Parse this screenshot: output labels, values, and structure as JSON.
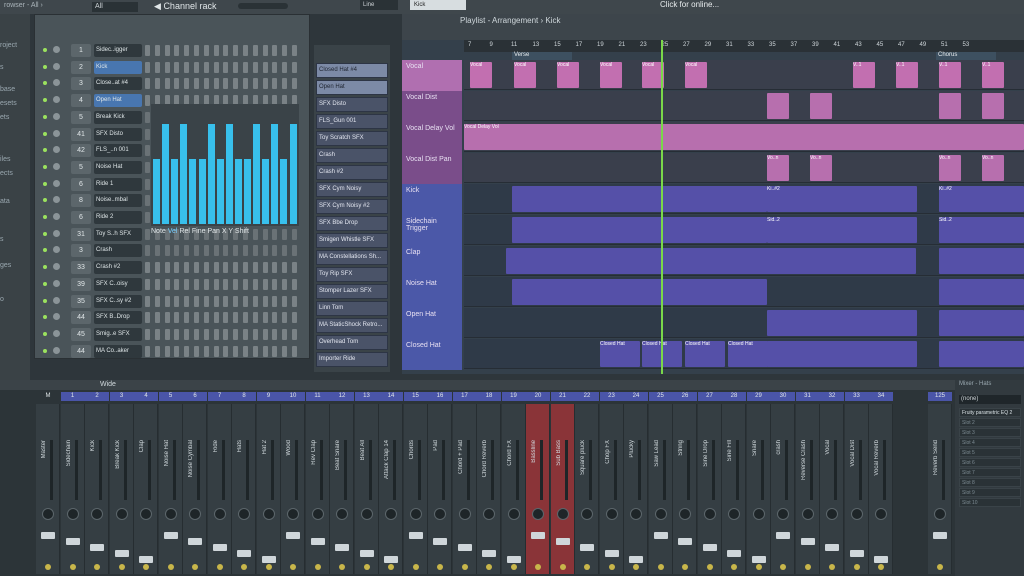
{
  "topbar": {
    "browser_filter": "All",
    "channel_rack_title": "Channel rack",
    "playlist_breadcrumb": "Playlist - Arrangement › Kick",
    "line_mode": "Line",
    "selected_channel": "Kick",
    "news": "Click for online..."
  },
  "browser": {
    "items": [
      "roject",
      "s",
      "base",
      "esets",
      "ets",
      "iles",
      "ects",
      "ata",
      "s",
      "ges",
      "o"
    ]
  },
  "channels": [
    {
      "num": "1",
      "name": "Sidec..igger"
    },
    {
      "num": "2",
      "name": "Kick",
      "selected": true
    },
    {
      "num": "3",
      "name": "Close..at #4"
    },
    {
      "num": "4",
      "name": "Open Hat",
      "selected": true
    },
    {
      "num": "5",
      "name": "Break Kick"
    },
    {
      "num": "41",
      "name": "SFX Disto"
    },
    {
      "num": "42",
      "name": "FLS_..n 001"
    },
    {
      "num": "5",
      "name": "Noise Hat"
    },
    {
      "num": "6",
      "name": "Ride 1"
    },
    {
      "num": "8",
      "name": "Noise..mbal"
    },
    {
      "num": "6",
      "name": "Ride 2"
    },
    {
      "num": "31",
      "name": "Toy S..h SFX"
    },
    {
      "num": "3",
      "name": "Crash"
    },
    {
      "num": "33",
      "name": "Crash #2"
    },
    {
      "num": "39",
      "name": "SFX C..oisy"
    },
    {
      "num": "35",
      "name": "SFX C..sy #2"
    },
    {
      "num": "44",
      "name": "SFX B..Drop"
    },
    {
      "num": "45",
      "name": "Smig..e SFX"
    },
    {
      "num": "44",
      "name": "MA Co..aker"
    }
  ],
  "pianoroll_labels": {
    "note": "Note",
    "vel": "Vel",
    "rel": "Rel",
    "fine": "Fine",
    "pan": "Pan",
    "x": "X",
    "y": "Y",
    "shift": "Shift"
  },
  "pianoroll_values": [
    0.55,
    0.85,
    0.55,
    0.85,
    0.55,
    0.55,
    0.85,
    0.55,
    0.85,
    0.55,
    0.55,
    0.85,
    0.55,
    0.85,
    0.55,
    0.85
  ],
  "picker": [
    {
      "name": "Closed Hat #4",
      "audio": true
    },
    {
      "name": "Open Hat",
      "audio": true
    },
    {
      "name": "SFX Disto"
    },
    {
      "name": "FLS_Gun 001"
    },
    {
      "name": "Toy Scratch SFX"
    },
    {
      "name": "Crash"
    },
    {
      "name": "Crash #2"
    },
    {
      "name": "SFX Cym Noisy"
    },
    {
      "name": "SFX Cym Noisy #2"
    },
    {
      "name": "SFX Bbe Drop"
    },
    {
      "name": "Smigen Whistle SFX"
    },
    {
      "name": "MA Constellations Sh..."
    },
    {
      "name": "Toy Rip SFX"
    },
    {
      "name": "Stomper Lazer SFX"
    },
    {
      "name": "Linn Tom"
    },
    {
      "name": "MA StaticShock Retro..."
    },
    {
      "name": "Overhead Tom"
    },
    {
      "name": "Importer Ride"
    }
  ],
  "ruler": [
    "7",
    "9",
    "11",
    "13",
    "15",
    "17",
    "19",
    "21",
    "23",
    "25",
    "27",
    "29",
    "31",
    "33",
    "35",
    "37",
    "39",
    "41",
    "43",
    "45",
    "47",
    "49",
    "51",
    "53"
  ],
  "markers": {
    "verse": "Verse",
    "chorus": "Chorus"
  },
  "tracks": [
    {
      "name": "Vocal",
      "color": "#b06fb0"
    },
    {
      "name": "Vocal Dist",
      "color": "#7a4d8a"
    },
    {
      "name": "Vocal Delay Vol",
      "color": "#7a4d8a"
    },
    {
      "name": "Vocal Dist Pan",
      "color": "#7a4d8a"
    },
    {
      "name": "Kick",
      "color": "#4b58a8"
    },
    {
      "name": "Sidechain Trigger",
      "color": "#4b58a8"
    },
    {
      "name": "Clap",
      "color": "#4b58a8"
    },
    {
      "name": "Noise Hat",
      "color": "#4b58a8"
    },
    {
      "name": "Open Hat",
      "color": "#4b58a8"
    },
    {
      "name": "Closed Hat",
      "color": "#4b58a8"
    }
  ],
  "clip_labels": {
    "vocal": "Vocal",
    "v1": "V..1",
    "delay": "Vocal Delay Vol",
    "von": "Vo..n",
    "ki": "Ki..#2",
    "sid": "Sid..2",
    "closed": "Closed Hat"
  },
  "mixer": {
    "title": "Wide",
    "slots_title": "Mixer - Hats",
    "insert_none": "(none)",
    "slots": [
      "Fruity parametric EQ 2",
      "Slot 2",
      "Slot 3",
      "Slot 4",
      "Slot 5",
      "Slot 6",
      "Slot 7",
      "Slot 8",
      "Slot 9",
      "Slot 10"
    ],
    "channels": [
      {
        "num": "M",
        "name": "Master"
      },
      {
        "num": "1",
        "name": "Sidechain"
      },
      {
        "num": "2",
        "name": "Kick"
      },
      {
        "num": "3",
        "name": "Break Kick"
      },
      {
        "num": "4",
        "name": "Clap"
      },
      {
        "num": "5",
        "name": "Noise Hat"
      },
      {
        "num": "6",
        "name": "Noise Cymbal"
      },
      {
        "num": "7",
        "name": "Ride"
      },
      {
        "num": "8",
        "name": "Hats"
      },
      {
        "num": "9",
        "name": "Hat 2"
      },
      {
        "num": "10",
        "name": "Wood"
      },
      {
        "num": "11",
        "name": "Rev Clap"
      },
      {
        "num": "12",
        "name": "Beat Snare"
      },
      {
        "num": "13",
        "name": "Beat All"
      },
      {
        "num": "14",
        "name": "Attack Clap 14"
      },
      {
        "num": "15",
        "name": "Chords"
      },
      {
        "num": "16",
        "name": "Pad"
      },
      {
        "num": "17",
        "name": "Chord + Pad"
      },
      {
        "num": "18",
        "name": "Chord Reverb"
      },
      {
        "num": "19",
        "name": "Chord FX"
      },
      {
        "num": "20",
        "name": "Bassline"
      },
      {
        "num": "21",
        "name": "Sub Bass"
      },
      {
        "num": "22",
        "name": "Square pluck"
      },
      {
        "num": "23",
        "name": "Chop FX"
      },
      {
        "num": "24",
        "name": "Plucky"
      },
      {
        "num": "25",
        "name": "Saw Lead"
      },
      {
        "num": "26",
        "name": "String"
      },
      {
        "num": "27",
        "name": "Sine Drop"
      },
      {
        "num": "28",
        "name": "Sine Fill"
      },
      {
        "num": "29",
        "name": "Snare"
      },
      {
        "num": "30",
        "name": "crash"
      },
      {
        "num": "31",
        "name": "Reverse Crash"
      },
      {
        "num": "32",
        "name": "Vocal"
      },
      {
        "num": "33",
        "name": "Vocal Dist"
      },
      {
        "num": "34",
        "name": "Vocal Reverb"
      },
      {
        "num": "125",
        "name": "Reverb Send"
      }
    ]
  },
  "colors": {
    "accent_blue": "#4b58a8",
    "pink": "#c26fb0",
    "green_meter": "#9be25e",
    "red_strip": "#8a3438"
  }
}
